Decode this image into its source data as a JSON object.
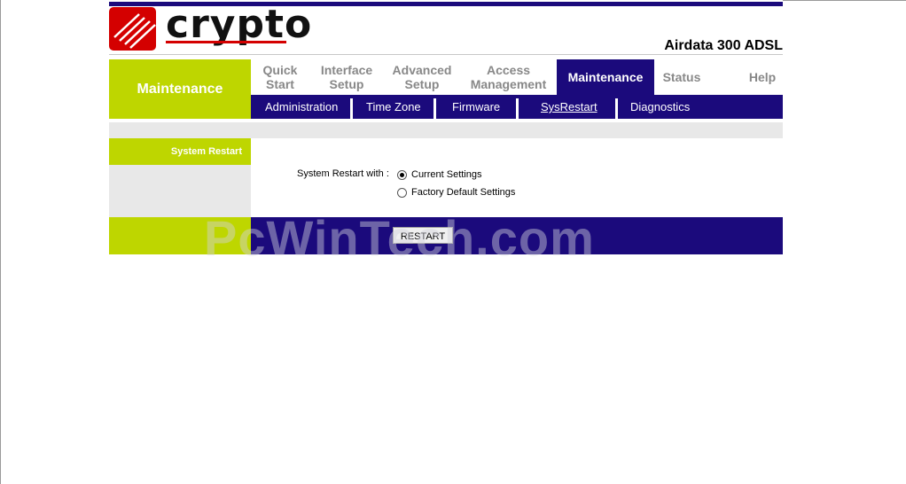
{
  "brand": {
    "logo_text": "crypto",
    "model": "Airdata 300 ADSL",
    "accent_color": "#d40000"
  },
  "colors": {
    "navy": "#1b0a7c",
    "lime": "#bed600",
    "gray": "#e8e8e8"
  },
  "section": {
    "title": "Maintenance"
  },
  "nav": {
    "tabs": [
      {
        "line1": "Quick",
        "line2": "Start"
      },
      {
        "line1": "Interface",
        "line2": "Setup"
      },
      {
        "line1": "Advanced",
        "line2": "Setup"
      },
      {
        "line1": "Access",
        "line2": "Management"
      },
      {
        "line1": "Maintenance",
        "line2": "",
        "active": true
      },
      {
        "line1": "Status",
        "line2": ""
      },
      {
        "line1": "Help",
        "line2": ""
      }
    ]
  },
  "subnav": {
    "items": [
      {
        "label": "Administration"
      },
      {
        "label": "Time Zone"
      },
      {
        "label": "Firmware"
      },
      {
        "label": "SysRestart",
        "active": true
      },
      {
        "label": "Diagnostics"
      }
    ]
  },
  "panel": {
    "side_label": "System Restart",
    "form_label": "System Restart with :",
    "options": [
      {
        "label": "Current Settings",
        "checked": true
      },
      {
        "label": "Factory Default Settings",
        "checked": false
      }
    ],
    "button_label": "RESTART"
  },
  "watermark": "PcWinTech.com"
}
